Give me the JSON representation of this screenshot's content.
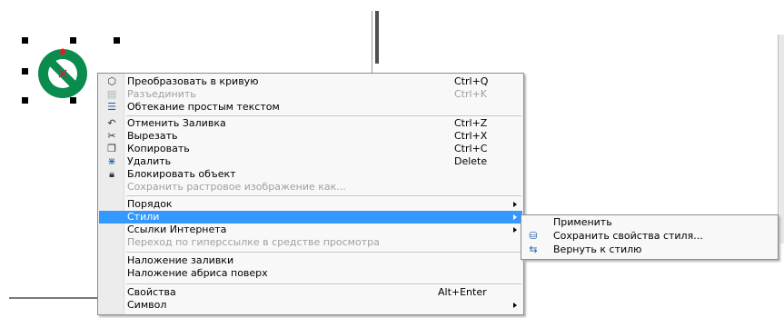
{
  "context_menu": {
    "items": [
      {
        "label": "Преобразовать в кривую",
        "shortcut": "Ctrl+Q",
        "icon": "convert-curve-icon",
        "enabled": true
      },
      {
        "label": "Разъединить",
        "shortcut": "Ctrl+K",
        "icon": "break-apart-icon",
        "enabled": false
      },
      {
        "label": "Обтекание простым текстом",
        "shortcut": "",
        "icon": "text-wrap-icon",
        "enabled": true
      },
      {
        "label": "Отменить Заливка",
        "shortcut": "Ctrl+Z",
        "icon": "undo-icon",
        "enabled": true
      },
      {
        "label": "Вырезать",
        "shortcut": "Ctrl+X",
        "icon": "scissors-icon",
        "enabled": true
      },
      {
        "label": "Копировать",
        "shortcut": "Ctrl+C",
        "icon": "copy-icon",
        "enabled": true
      },
      {
        "label": "Удалить",
        "shortcut": "Delete",
        "icon": "delete-icon",
        "enabled": true
      },
      {
        "label": "Блокировать объект",
        "shortcut": "",
        "icon": "lock-icon",
        "enabled": true
      },
      {
        "label": "Сохранить растровое изображение как...",
        "shortcut": "",
        "icon": "",
        "enabled": false
      },
      {
        "label": "Порядок",
        "shortcut": "",
        "icon": "",
        "enabled": true,
        "submenu": true
      },
      {
        "label": "Стили",
        "shortcut": "",
        "icon": "",
        "enabled": true,
        "submenu": true,
        "highlighted": true
      },
      {
        "label": "Ссылки Интернета",
        "shortcut": "",
        "icon": "",
        "enabled": true,
        "submenu": true
      },
      {
        "label": "Переход по гиперссылке в средстве просмотра",
        "shortcut": "",
        "icon": "",
        "enabled": false
      },
      {
        "label": "Наложение заливки",
        "shortcut": "",
        "icon": "",
        "enabled": true
      },
      {
        "label": "Наложение абриса поверх",
        "shortcut": "",
        "icon": "",
        "enabled": true
      },
      {
        "label": "Свойства",
        "shortcut": "Alt+Enter",
        "icon": "",
        "enabled": true
      },
      {
        "label": "Символ",
        "shortcut": "",
        "icon": "",
        "enabled": true,
        "submenu": true
      }
    ]
  },
  "styles_submenu": {
    "items": [
      {
        "label": "Применить",
        "icon": ""
      },
      {
        "label": "Сохранить свойства стиля...",
        "icon": "save-style-icon"
      },
      {
        "label": "Вернуть к стилю",
        "icon": "revert-style-icon"
      }
    ]
  },
  "colors": {
    "highlight": "#3399ff",
    "object_fill": "#0a8c4e"
  }
}
